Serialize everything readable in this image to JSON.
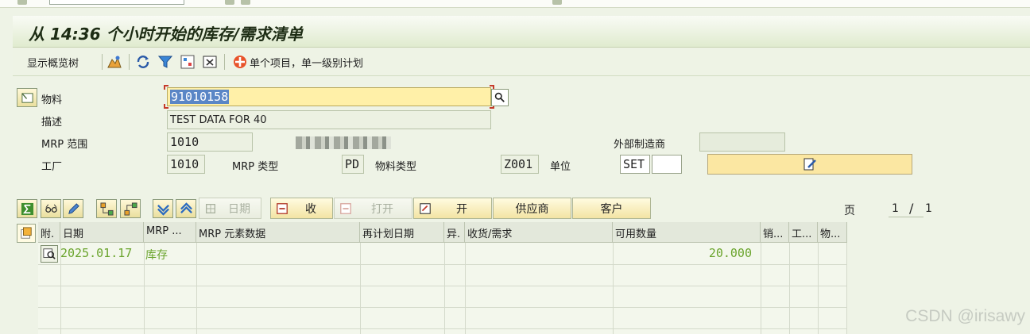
{
  "window": {
    "title": "从 14:36 个小时开始的库存/需求清单"
  },
  "app_toolbar": {
    "show_overview_tree": "显示概览树",
    "single_item_planning": "单个项目，单一级别计划",
    "icons": [
      "overview-icon",
      "refresh-icon",
      "filter-icon",
      "settings-icon",
      "export-icon",
      "single-item-icon"
    ]
  },
  "header": {
    "material_label": "物料",
    "material_value": "91010158",
    "desc_label": "描述",
    "desc_value": "TEST DATA FOR 40",
    "mrp_area_label": "MRP 范围",
    "mrp_area_value": "1010",
    "ext_mfr_label": "外部制造商",
    "plant_label": "工厂",
    "plant_value": "1010",
    "mrp_type_label": "MRP 类型",
    "mrp_type_value": "PD",
    "material_type_label": "物料类型",
    "material_type_value": "Z001",
    "unit_label": "单位",
    "unit_value": "SET"
  },
  "grid_toolbar": {
    "date_btn": "日期",
    "receipt_btn": "收",
    "open_btn": "打开",
    "open2_btn": "开",
    "supplier_btn": "供应商",
    "customer_btn": "客户",
    "page_label": "页",
    "page_current": "1",
    "page_sep": "/",
    "page_total": "1"
  },
  "table": {
    "columns": [
      "附.",
      "日期",
      "MRP ...",
      "MRP 元素数据",
      "再计划日期",
      "异.",
      "收货/需求",
      "可用数量",
      "销...",
      "工...",
      "物..."
    ],
    "rows": [
      {
        "date": "2025.01.17",
        "mrp_element": "库存",
        "available_qty": "20.000"
      }
    ]
  },
  "watermark": "CSDN @irisawy",
  "colors": {
    "accent_green": "#6aa42c",
    "yellow_field": "#fff0a8",
    "background": "#eef3e6"
  }
}
